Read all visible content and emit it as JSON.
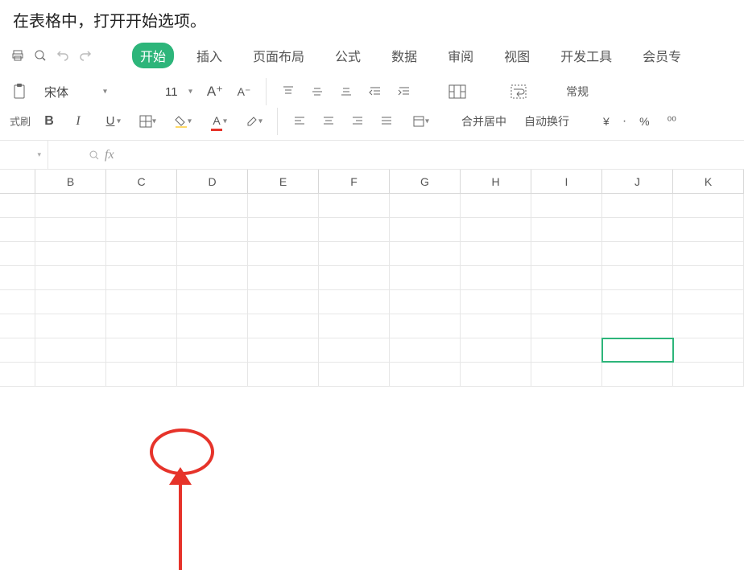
{
  "instruction": "在表格中，打开开始选项。",
  "tabs": {
    "start": "开始",
    "insert": "插入",
    "layout": "页面布局",
    "formula": "公式",
    "data": "数据",
    "review": "审阅",
    "view": "视图",
    "dev": "开发工具",
    "member": "会员专"
  },
  "toolbar": {
    "paste_label": "式刷",
    "font_name": "宋体",
    "font_size": "11",
    "merge": "合并居中",
    "wrap": "自动换行",
    "number_format": "常规",
    "currency": "¥",
    "percent": "%",
    "thousands": "⁰⁰"
  },
  "formula_bar": {
    "name_box": "",
    "fx": "fx"
  },
  "grid": {
    "columns": [
      "B",
      "C",
      "D",
      "E",
      "F",
      "G",
      "H",
      "I",
      "J",
      "K"
    ],
    "row_count": 8,
    "selected": {
      "col": "J",
      "row": 7
    }
  }
}
